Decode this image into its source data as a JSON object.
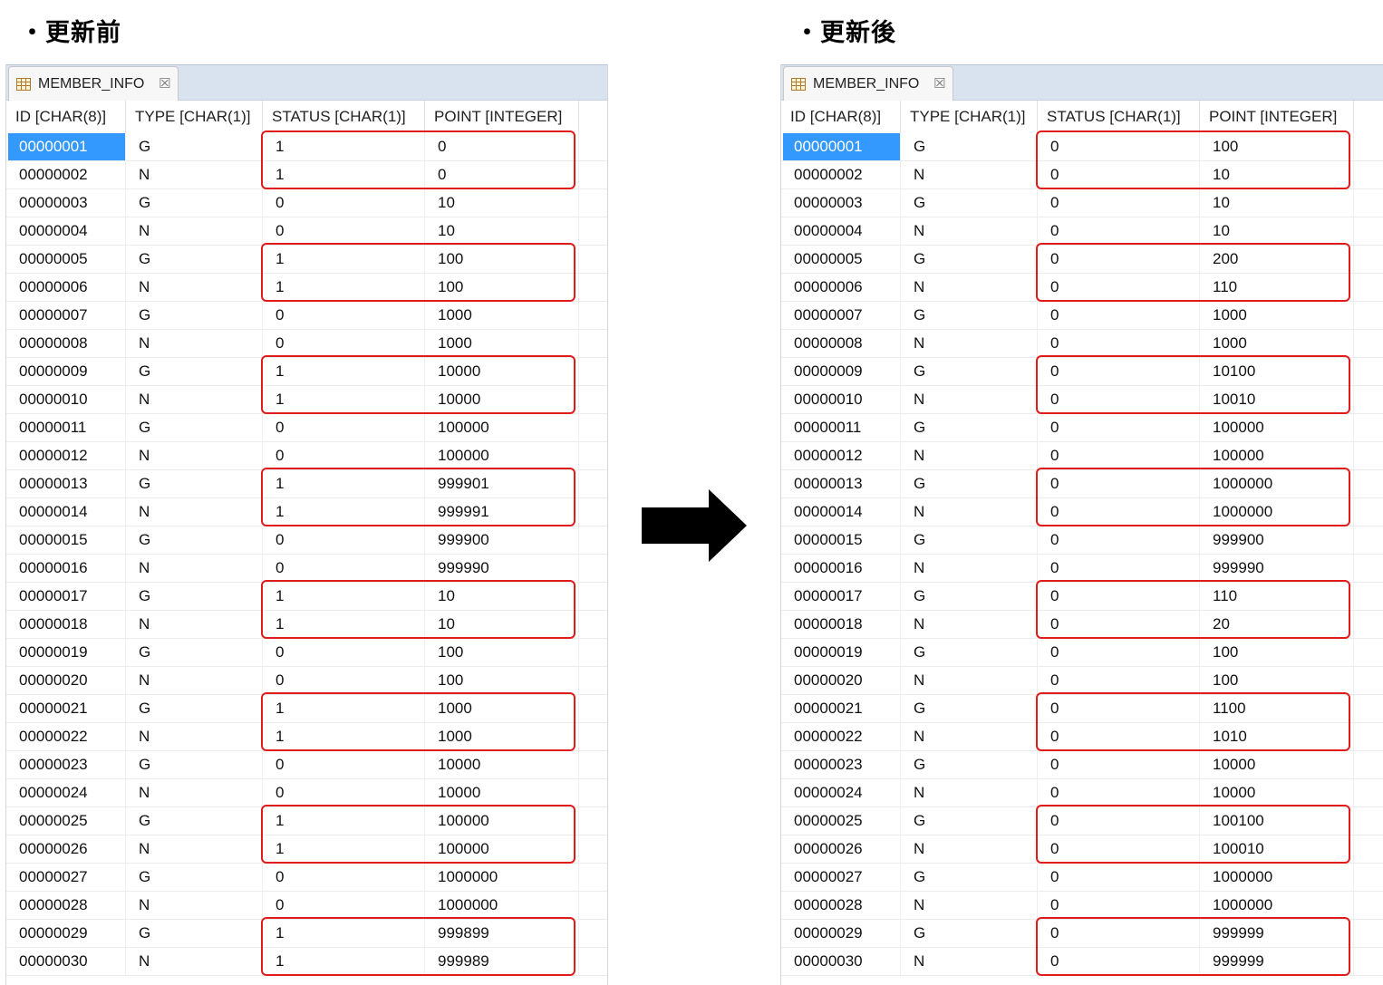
{
  "left": {
    "heading": "・更新前",
    "tab_label": "MEMBER_INFO",
    "tab_close": "☒",
    "columns": [
      "ID [CHAR(8)]",
      "TYPE [CHAR(1)]",
      "STATUS [CHAR(1)]",
      "POINT [INTEGER]"
    ],
    "rows": [
      [
        "00000001",
        "G",
        "1",
        "0"
      ],
      [
        "00000002",
        "N",
        "1",
        "0"
      ],
      [
        "00000003",
        "G",
        "0",
        "10"
      ],
      [
        "00000004",
        "N",
        "0",
        "10"
      ],
      [
        "00000005",
        "G",
        "1",
        "100"
      ],
      [
        "00000006",
        "N",
        "1",
        "100"
      ],
      [
        "00000007",
        "G",
        "0",
        "1000"
      ],
      [
        "00000008",
        "N",
        "0",
        "1000"
      ],
      [
        "00000009",
        "G",
        "1",
        "10000"
      ],
      [
        "00000010",
        "N",
        "1",
        "10000"
      ],
      [
        "00000011",
        "G",
        "0",
        "100000"
      ],
      [
        "00000012",
        "N",
        "0",
        "100000"
      ],
      [
        "00000013",
        "G",
        "1",
        "999901"
      ],
      [
        "00000014",
        "N",
        "1",
        "999991"
      ],
      [
        "00000015",
        "G",
        "0",
        "999900"
      ],
      [
        "00000016",
        "N",
        "0",
        "999990"
      ],
      [
        "00000017",
        "G",
        "1",
        "10"
      ],
      [
        "00000018",
        "N",
        "1",
        "10"
      ],
      [
        "00000019",
        "G",
        "0",
        "100"
      ],
      [
        "00000020",
        "N",
        "0",
        "100"
      ],
      [
        "00000021",
        "G",
        "1",
        "1000"
      ],
      [
        "00000022",
        "N",
        "1",
        "1000"
      ],
      [
        "00000023",
        "G",
        "0",
        "10000"
      ],
      [
        "00000024",
        "N",
        "0",
        "10000"
      ],
      [
        "00000025",
        "G",
        "1",
        "100000"
      ],
      [
        "00000026",
        "N",
        "1",
        "100000"
      ],
      [
        "00000027",
        "G",
        "0",
        "1000000"
      ],
      [
        "00000028",
        "N",
        "0",
        "1000000"
      ],
      [
        "00000029",
        "G",
        "1",
        "999899"
      ],
      [
        "00000030",
        "N",
        "1",
        "999989"
      ]
    ]
  },
  "right": {
    "heading": "・更新後",
    "tab_label": "MEMBER_INFO",
    "tab_close": "☒",
    "columns": [
      "ID [CHAR(8)]",
      "TYPE [CHAR(1)]",
      "STATUS [CHAR(1)]",
      "POINT [INTEGER]"
    ],
    "rows": [
      [
        "00000001",
        "G",
        "0",
        "100"
      ],
      [
        "00000002",
        "N",
        "0",
        "10"
      ],
      [
        "00000003",
        "G",
        "0",
        "10"
      ],
      [
        "00000004",
        "N",
        "0",
        "10"
      ],
      [
        "00000005",
        "G",
        "0",
        "200"
      ],
      [
        "00000006",
        "N",
        "0",
        "110"
      ],
      [
        "00000007",
        "G",
        "0",
        "1000"
      ],
      [
        "00000008",
        "N",
        "0",
        "1000"
      ],
      [
        "00000009",
        "G",
        "0",
        "10100"
      ],
      [
        "00000010",
        "N",
        "0",
        "10010"
      ],
      [
        "00000011",
        "G",
        "0",
        "100000"
      ],
      [
        "00000012",
        "N",
        "0",
        "100000"
      ],
      [
        "00000013",
        "G",
        "0",
        "1000000"
      ],
      [
        "00000014",
        "N",
        "0",
        "1000000"
      ],
      [
        "00000015",
        "G",
        "0",
        "999900"
      ],
      [
        "00000016",
        "N",
        "0",
        "999990"
      ],
      [
        "00000017",
        "G",
        "0",
        "110"
      ],
      [
        "00000018",
        "N",
        "0",
        "20"
      ],
      [
        "00000019",
        "G",
        "0",
        "100"
      ],
      [
        "00000020",
        "N",
        "0",
        "100"
      ],
      [
        "00000021",
        "G",
        "0",
        "1100"
      ],
      [
        "00000022",
        "N",
        "0",
        "1010"
      ],
      [
        "00000023",
        "G",
        "0",
        "10000"
      ],
      [
        "00000024",
        "N",
        "0",
        "10000"
      ],
      [
        "00000025",
        "G",
        "0",
        "100100"
      ],
      [
        "00000026",
        "N",
        "0",
        "100010"
      ],
      [
        "00000027",
        "G",
        "0",
        "1000000"
      ],
      [
        "00000028",
        "N",
        "0",
        "1000000"
      ],
      [
        "00000029",
        "G",
        "0",
        "999999"
      ],
      [
        "00000030",
        "N",
        "0",
        "999999"
      ]
    ]
  },
  "highlighted_row_pairs": [
    [
      1,
      2
    ],
    [
      5,
      6
    ],
    [
      9,
      10
    ],
    [
      13,
      14
    ],
    [
      17,
      18
    ],
    [
      21,
      22
    ],
    [
      25,
      26
    ],
    [
      29,
      30
    ]
  ],
  "selected_row": 1,
  "colors": {
    "highlight_box": "#e11a1a",
    "selection": "#3399ff",
    "tab_bar": "#d8e3ef"
  },
  "icons": [
    "table-icon",
    "close-icon",
    "right-arrow-icon"
  ]
}
